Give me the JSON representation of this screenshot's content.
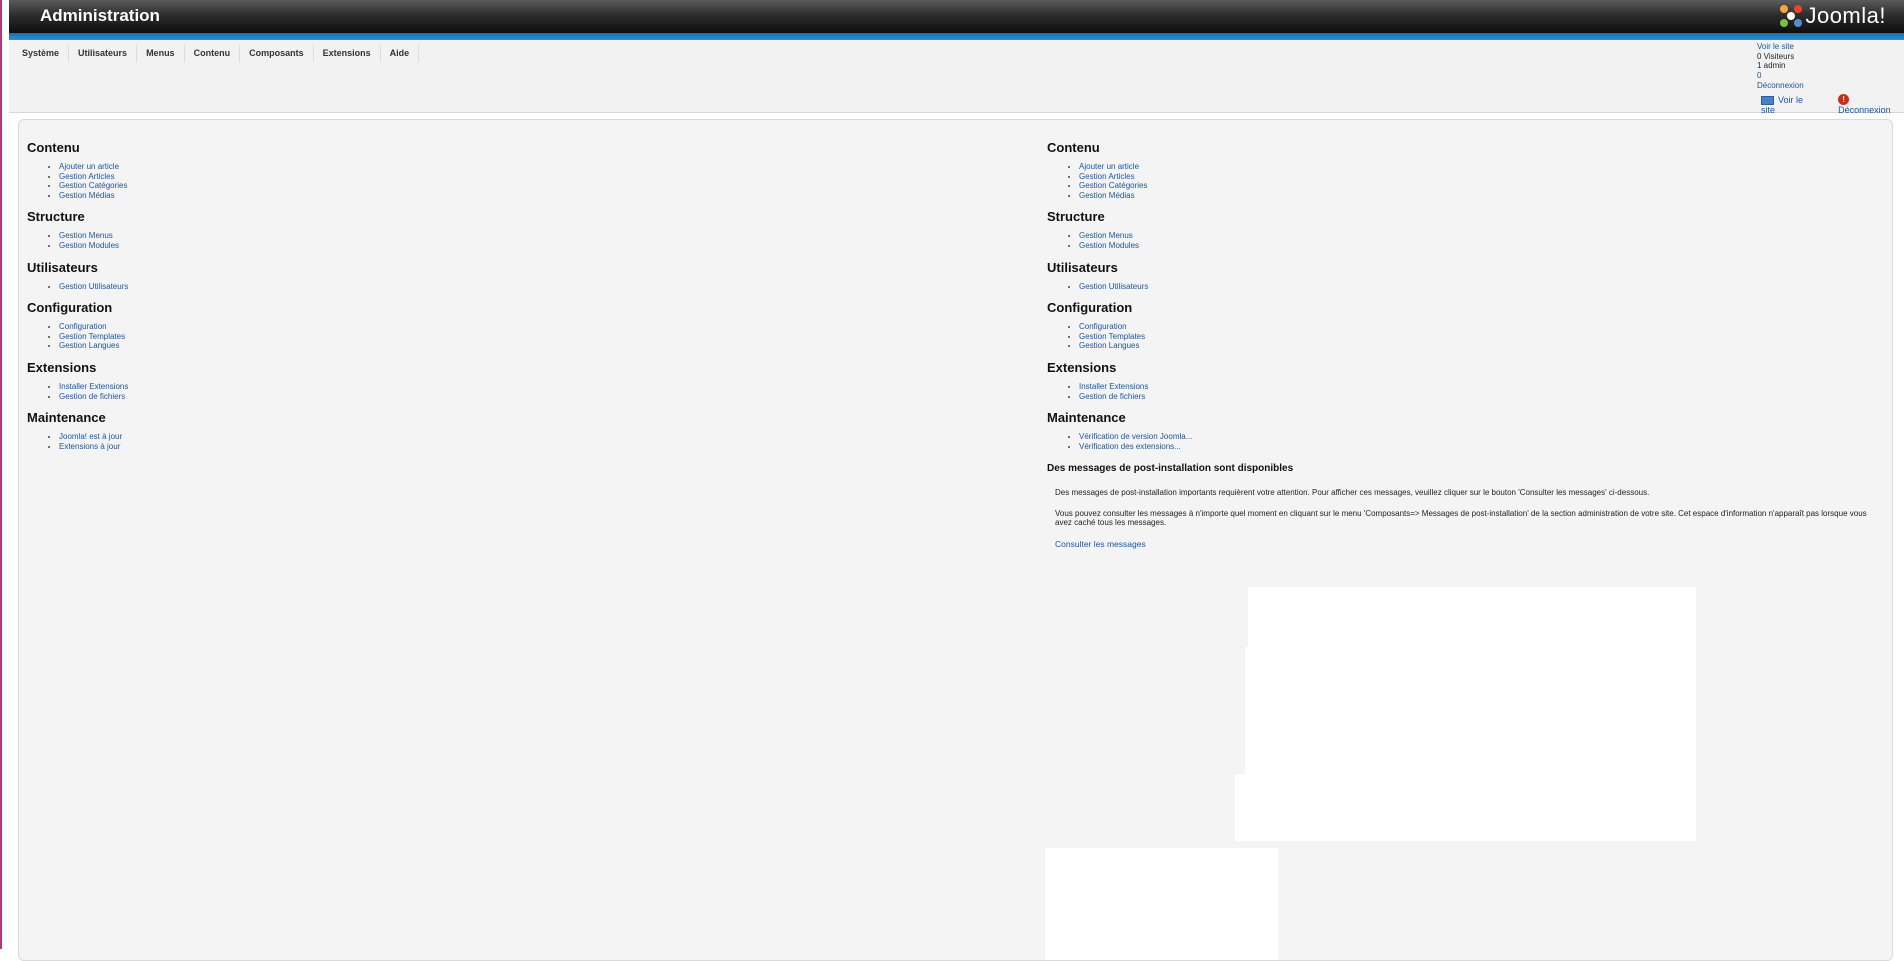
{
  "header": {
    "title": "Administration",
    "logo_text": "Joomla!"
  },
  "menu": {
    "items": [
      "Système",
      "Utilisateurs",
      "Menus",
      "Contenu",
      "Composants",
      "Extensions",
      "Aide"
    ]
  },
  "status": {
    "overlap_lines": [
      "Voir le site",
      "0 Visiteurs",
      "1 admin",
      "0",
      "Déconnexion"
    ],
    "view_site": "Voir le site",
    "logout": "Déconnexion"
  },
  "left_column": {
    "sections": [
      {
        "title": "Contenu",
        "links": [
          "Ajouter un article",
          "Gestion Articles",
          "Gestion Catégories",
          "Gestion Médias"
        ]
      },
      {
        "title": "Structure",
        "links": [
          "Gestion Menus",
          "Gestion Modules"
        ]
      },
      {
        "title": "Utilisateurs",
        "links": [
          "Gestion Utilisateurs"
        ]
      },
      {
        "title": "Configuration",
        "links": [
          "Configuration",
          "Gestion Templates",
          "Gestion Langues"
        ]
      },
      {
        "title": "Extensions",
        "links": [
          "Installer Extensions",
          "Gestion de fichiers"
        ]
      },
      {
        "title": "Maintenance",
        "links": [
          "Joomla! est à jour",
          "Extensions à jour"
        ]
      }
    ]
  },
  "right_column": {
    "sections": [
      {
        "title": "Contenu",
        "links": [
          "Ajouter un article",
          "Gestion Articles",
          "Gestion Catégories",
          "Gestion Médias"
        ]
      },
      {
        "title": "Structure",
        "links": [
          "Gestion Menus",
          "Gestion Modules"
        ]
      },
      {
        "title": "Utilisateurs",
        "links": [
          "Gestion Utilisateurs"
        ]
      },
      {
        "title": "Configuration",
        "links": [
          "Configuration",
          "Gestion Templates",
          "Gestion Langues"
        ]
      },
      {
        "title": "Extensions",
        "links": [
          "Installer Extensions",
          "Gestion de fichiers"
        ]
      },
      {
        "title": "Maintenance",
        "links": [
          "Vérification de version Joomla...",
          "Vérification des extensions..."
        ]
      }
    ],
    "postinstall": {
      "heading": "Des messages de post-installation sont disponibles",
      "paragraph1": "Des messages de post-installation importants requièrent votre attention. Pour afficher ces messages, veuillez cliquer sur le bouton 'Consulter les messages' ci-dessous.",
      "paragraph2": "Vous pouvez consulter les messages à n'importe quel moment en cliquant sur le menu 'Composants=> Messages de post-installation' de la section administration de votre site. Cet espace d'information n'apparaît pas lorsque vous avez caché tous les messages.",
      "link": "Consulter les messages"
    }
  },
  "colors": {
    "link": "#1b57a2",
    "header_dark": "#0d0d0d",
    "header_stripe": "#2e8fd0",
    "panel_bg": "#f4f4f4",
    "logout_icon": "#d12b14"
  }
}
